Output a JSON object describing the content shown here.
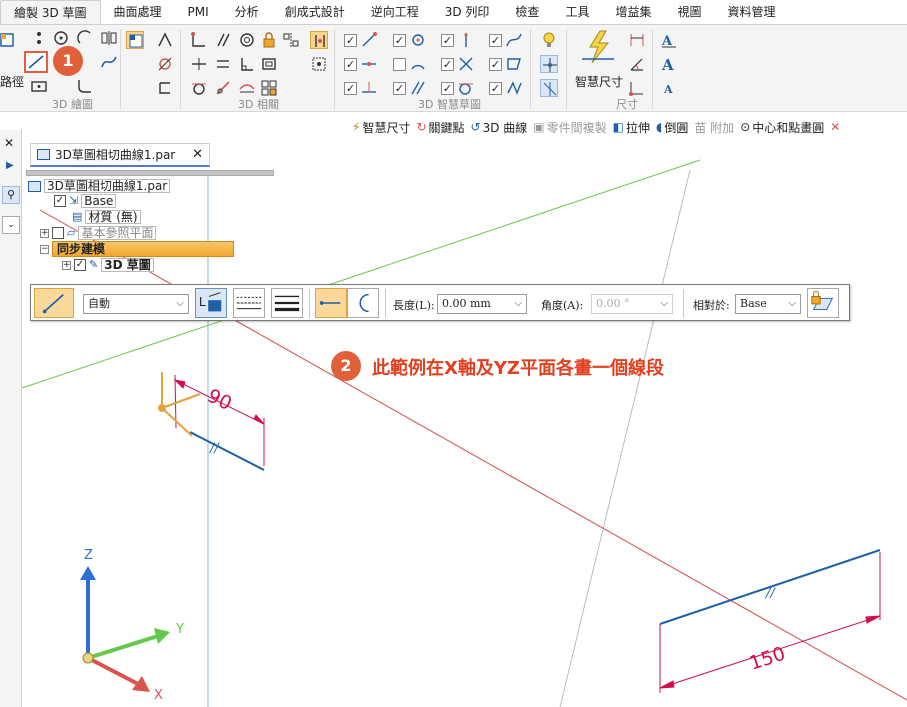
{
  "ribbon_tabs": [
    "繪製 3D 草圖",
    "曲面處理",
    "PMI",
    "分析",
    "創成式設計",
    "逆向工程",
    "3D 列印",
    "檢查",
    "工具",
    "增益集",
    "視圖",
    "資料管理"
  ],
  "ribbon": {
    "path_label": "路徑",
    "groups": {
      "draw": "3D 繪圖",
      "relations": "3D 相關",
      "intellisketch": "3D 智慧草圖",
      "dimension": "尺寸"
    },
    "smart_dimension": "智慧尺寸"
  },
  "quick_toolbar": {
    "smart_dim": "智慧尺寸",
    "keypoint": "關鍵點",
    "curve3d": "3D 曲線",
    "part_copy": "零件間複製",
    "extrude": "拉伸",
    "round": "倒圓",
    "add": "苗 附加",
    "center_point_circle": "中心和點畫圓"
  },
  "document_tab": {
    "title": "3D草圖相切曲線1.par"
  },
  "tree": {
    "root": "3D草圖相切曲線1.par",
    "base": "Base",
    "material": "材質 (無)",
    "ref_planes": "基本參照平面",
    "sync": "同步建模",
    "sketch": "3D 草圖"
  },
  "command_bar": {
    "mode": "自動",
    "length_label": "長度(L):",
    "length_value": "0.00 mm",
    "angle_label": "角度(A):",
    "angle_value": "0.00 °",
    "relative_label": "相對於:",
    "relative_value": "Base"
  },
  "callouts": {
    "one": "1",
    "two": "2",
    "text": "此範例在X軸及YZ平面各畫一個線段"
  },
  "viewport": {
    "dim_90": "90",
    "dim_150": "150",
    "axis_x": "X",
    "axis_y": "Y",
    "axis_z": "Z"
  },
  "colors": {
    "accent_orange": "#e0603a",
    "callout_red": "#e2401f",
    "dimension_magenta": "#d0104a",
    "segment_blue": "#1f5fa8",
    "axis_green": "#64c84a",
    "axis_red": "#d9534f"
  }
}
